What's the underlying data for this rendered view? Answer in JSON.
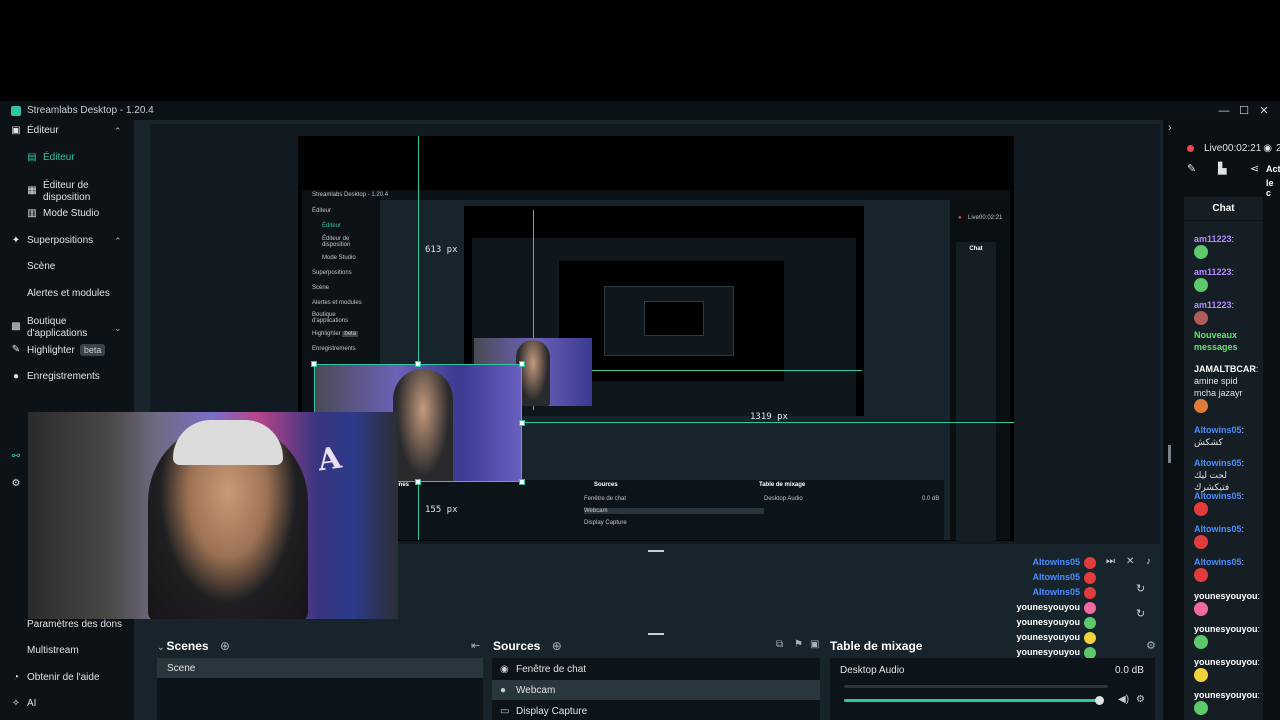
{
  "window": {
    "title": "Streamlabs Desktop - 1.20.4",
    "min_icon": "minimize-icon",
    "max_icon": "maximize-icon",
    "close_icon": "close-icon"
  },
  "sidebar": {
    "items": [
      {
        "label": "Éditeur",
        "icon": "editor-icon"
      },
      {
        "label": "Éditeur",
        "icon": "editor-page-icon"
      },
      {
        "label": "Éditeur de disposition",
        "icon": "layout-icon"
      },
      {
        "label": "Mode Studio",
        "icon": "studio-icon"
      },
      {
        "label": "Superpositions",
        "icon": "overlays-icon"
      },
      {
        "label": "Scène"
      },
      {
        "label": "Alertes et modules"
      },
      {
        "label": "Boutique d'applications",
        "icon": "store-icon"
      },
      {
        "label": "Highlighter",
        "icon": "highlighter-icon",
        "badge": "beta"
      },
      {
        "label": "Enregistrements",
        "icon": "recordings-icon"
      },
      {
        "label": "Paramètres des dons"
      },
      {
        "label": "Multistream"
      },
      {
        "label": "Obtenir de l'aide",
        "icon": "help-icon"
      },
      {
        "label": "AI",
        "icon": "ai-icon"
      }
    ]
  },
  "preview": {
    "guide_labels": [
      "613 px",
      "1319 px",
      "155 px"
    ]
  },
  "nested_app": {
    "title": "Streamlabs Desktop - 1.20.4",
    "items": [
      "Éditeur",
      "Éditeur",
      "Éditeur de disposition",
      "Mode Studio",
      "Superpositions",
      "Scène",
      "Alertes et modules",
      "Boutique d'applications",
      "Highlighter",
      "Enregistrements"
    ],
    "badge": "beta",
    "live": "Live00:02:21",
    "chat": "Chat",
    "docks": [
      "Scenes",
      "Sources",
      "Table de mixage"
    ],
    "sources": [
      "Fenêtre de chat",
      "Webcam",
      "Display Capture"
    ],
    "audio": "Desktop Audio",
    "db": "0.0 dB"
  },
  "overlay_chat": [
    {
      "name": "Altowins05",
      "color": "#4d8cff"
    },
    {
      "name": "Altowins05",
      "color": "#4d8cff"
    },
    {
      "name": "Altowins05",
      "color": "#4d8cff"
    },
    {
      "name": "younesyouyou",
      "color": "#ffffff"
    },
    {
      "name": "younesyouyou",
      "color": "#ffffff"
    },
    {
      "name": "younesyouyou",
      "color": "#ffffff"
    },
    {
      "name": "younesyouyou",
      "color": "#ffffff"
    }
  ],
  "docks": {
    "scenes": {
      "title": "Scenes",
      "items": [
        "Scene"
      ]
    },
    "sources": {
      "title": "Sources",
      "items": [
        {
          "label": "Fenêtre de chat",
          "icon": "chat-window-icon"
        },
        {
          "label": "Webcam",
          "icon": "webcam-icon"
        },
        {
          "label": "Display Capture",
          "icon": "display-icon"
        }
      ]
    },
    "mixer": {
      "title": "Table de mixage",
      "channel": "Desktop Audio",
      "db": "0.0 dB",
      "volume": 0.98
    }
  },
  "right_panel": {
    "live": "Live",
    "time": "00:02:21",
    "viewers": "2",
    "activity_partial": "Act",
    "activity_partial2": "le c",
    "chat_title": "Chat"
  },
  "chat": [
    {
      "name": "am11223",
      "text": ":",
      "color": "#b38bff",
      "emote": "#5cc96b"
    },
    {
      "name": "am11223",
      "text": ":",
      "color": "#b38bff",
      "emote": "#5cc96b"
    },
    {
      "name": "am11223",
      "text": ":",
      "color": "#b38bff",
      "emote": "#b35a5a"
    },
    {
      "name": "Nouveaux messages",
      "text": "",
      "color": "#66e36b",
      "emote": ""
    },
    {
      "name": "JAMALTBCAR",
      "text": ": amine spid mcha jazayr",
      "color": "#ffffff",
      "emote": "#e07a3a"
    },
    {
      "name": "Altowins05",
      "text": ": كشكش",
      "color": "#4d8cff",
      "emote": ""
    },
    {
      "name": "Altowins05",
      "text": ": لحت ليك فتيكشرك",
      "color": "#4d8cff",
      "emote": ""
    },
    {
      "name": "Altowins05",
      "text": ":",
      "color": "#4d8cff",
      "emote": "#e33c3c"
    },
    {
      "name": "Altowins05",
      "text": ":",
      "color": "#4d8cff",
      "emote": "#e33c3c"
    },
    {
      "name": "Altowins05",
      "text": ":",
      "color": "#4d8cff",
      "emote": "#e33c3c"
    },
    {
      "name": "younesyouyou",
      "text": ":",
      "color": "#ffffff",
      "emote": "#f06aa0"
    },
    {
      "name": "younesyouyou",
      "text": ":",
      "color": "#ffffff",
      "emote": "#5cc96b"
    },
    {
      "name": "younesyouyou",
      "text": ":",
      "color": "#ffffff",
      "emote": "#f0d23c"
    },
    {
      "name": "younesyouyou",
      "text": ":",
      "color": "#ffffff",
      "emote": "#5cc96b"
    }
  ],
  "colors": {
    "accent": "#31c3a2",
    "live": "#f0484e"
  }
}
